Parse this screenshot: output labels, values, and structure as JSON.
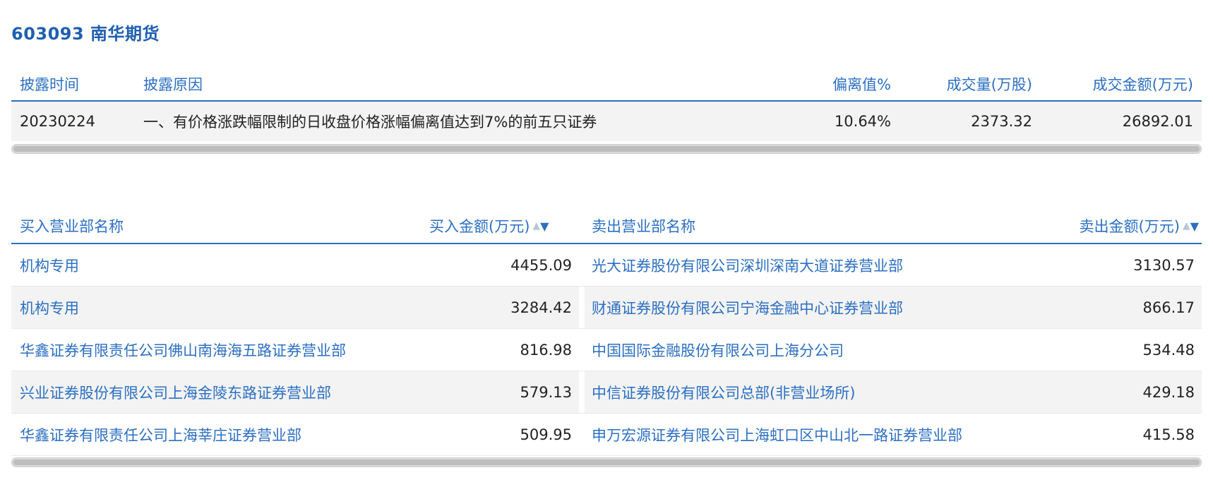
{
  "title": "603093 南华期货",
  "summary": {
    "headers": {
      "time": "披露时间",
      "reason": "披露原因",
      "deviation": "偏离值%",
      "volume": "成交量(万股)",
      "amount": "成交金额(万元)"
    },
    "row": {
      "time": "20230224",
      "reason": "一、有价格涨跌幅限制的日收盘价格涨幅偏离值达到7%的前五只证券",
      "deviation": "10.64%",
      "volume": "2373.32",
      "amount": "26892.01"
    }
  },
  "trades": {
    "headers": {
      "buy_name": "买入营业部名称",
      "buy_amount": "买入金额(万元)",
      "sell_name": "卖出营业部名称",
      "sell_amount": "卖出金额(万元)"
    },
    "sort_icons": {
      "up": "▲",
      "down": "▼"
    },
    "rows": [
      {
        "buy_name": "机构专用",
        "buy_amount": "4455.09",
        "sell_name": "光大证券股份有限公司深圳深南大道证券营业部",
        "sell_amount": "3130.57"
      },
      {
        "buy_name": "机构专用",
        "buy_amount": "3284.42",
        "sell_name": "财通证券股份有限公司宁海金融中心证券营业部",
        "sell_amount": "866.17"
      },
      {
        "buy_name": "华鑫证券有限责任公司佛山南海海五路证券营业部",
        "buy_amount": "816.98",
        "sell_name": "中国国际金融股份有限公司上海分公司",
        "sell_amount": "534.48"
      },
      {
        "buy_name": "兴业证券股份有限公司上海金陵东路证券营业部",
        "buy_amount": "579.13",
        "sell_name": "中信证券股份有限公司总部(非营业场所)",
        "sell_amount": "429.18"
      },
      {
        "buy_name": "华鑫证券有限责任公司上海莘庄证券营业部",
        "buy_amount": "509.95",
        "sell_name": "申万宏源证券有限公司上海虹口区中山北一路证券营业部",
        "sell_amount": "415.58"
      }
    ]
  },
  "colors": {
    "accent": "#2c6fc2",
    "title": "#1f5fb0",
    "row_alt": "#f3f3f3"
  }
}
